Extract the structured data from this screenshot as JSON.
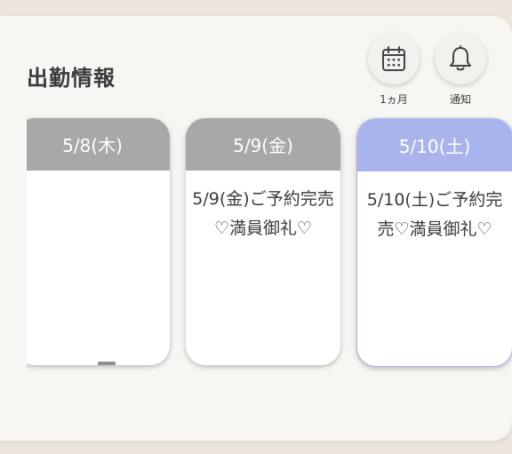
{
  "section": {
    "title": "出勤情報"
  },
  "controls": {
    "month_button": {
      "label": "1ヵ月",
      "icon": "calendar-icon"
    },
    "notice_button": {
      "label": "通知",
      "icon": "bell-icon"
    }
  },
  "schedule": [
    {
      "date": "5/8(木)",
      "text": "ー",
      "status": "off",
      "header_color": "#a8a8a8"
    },
    {
      "date": "5/9(金)",
      "text": "5/9(金)ご予約完売♡満員御礼♡",
      "status": "full",
      "header_color": "#a8a8a8"
    },
    {
      "date": "5/10(土)",
      "text": "5/10(土)ご予約完売♡満員御礼♡",
      "status": "full",
      "header_color": "#aab4ec"
    }
  ]
}
